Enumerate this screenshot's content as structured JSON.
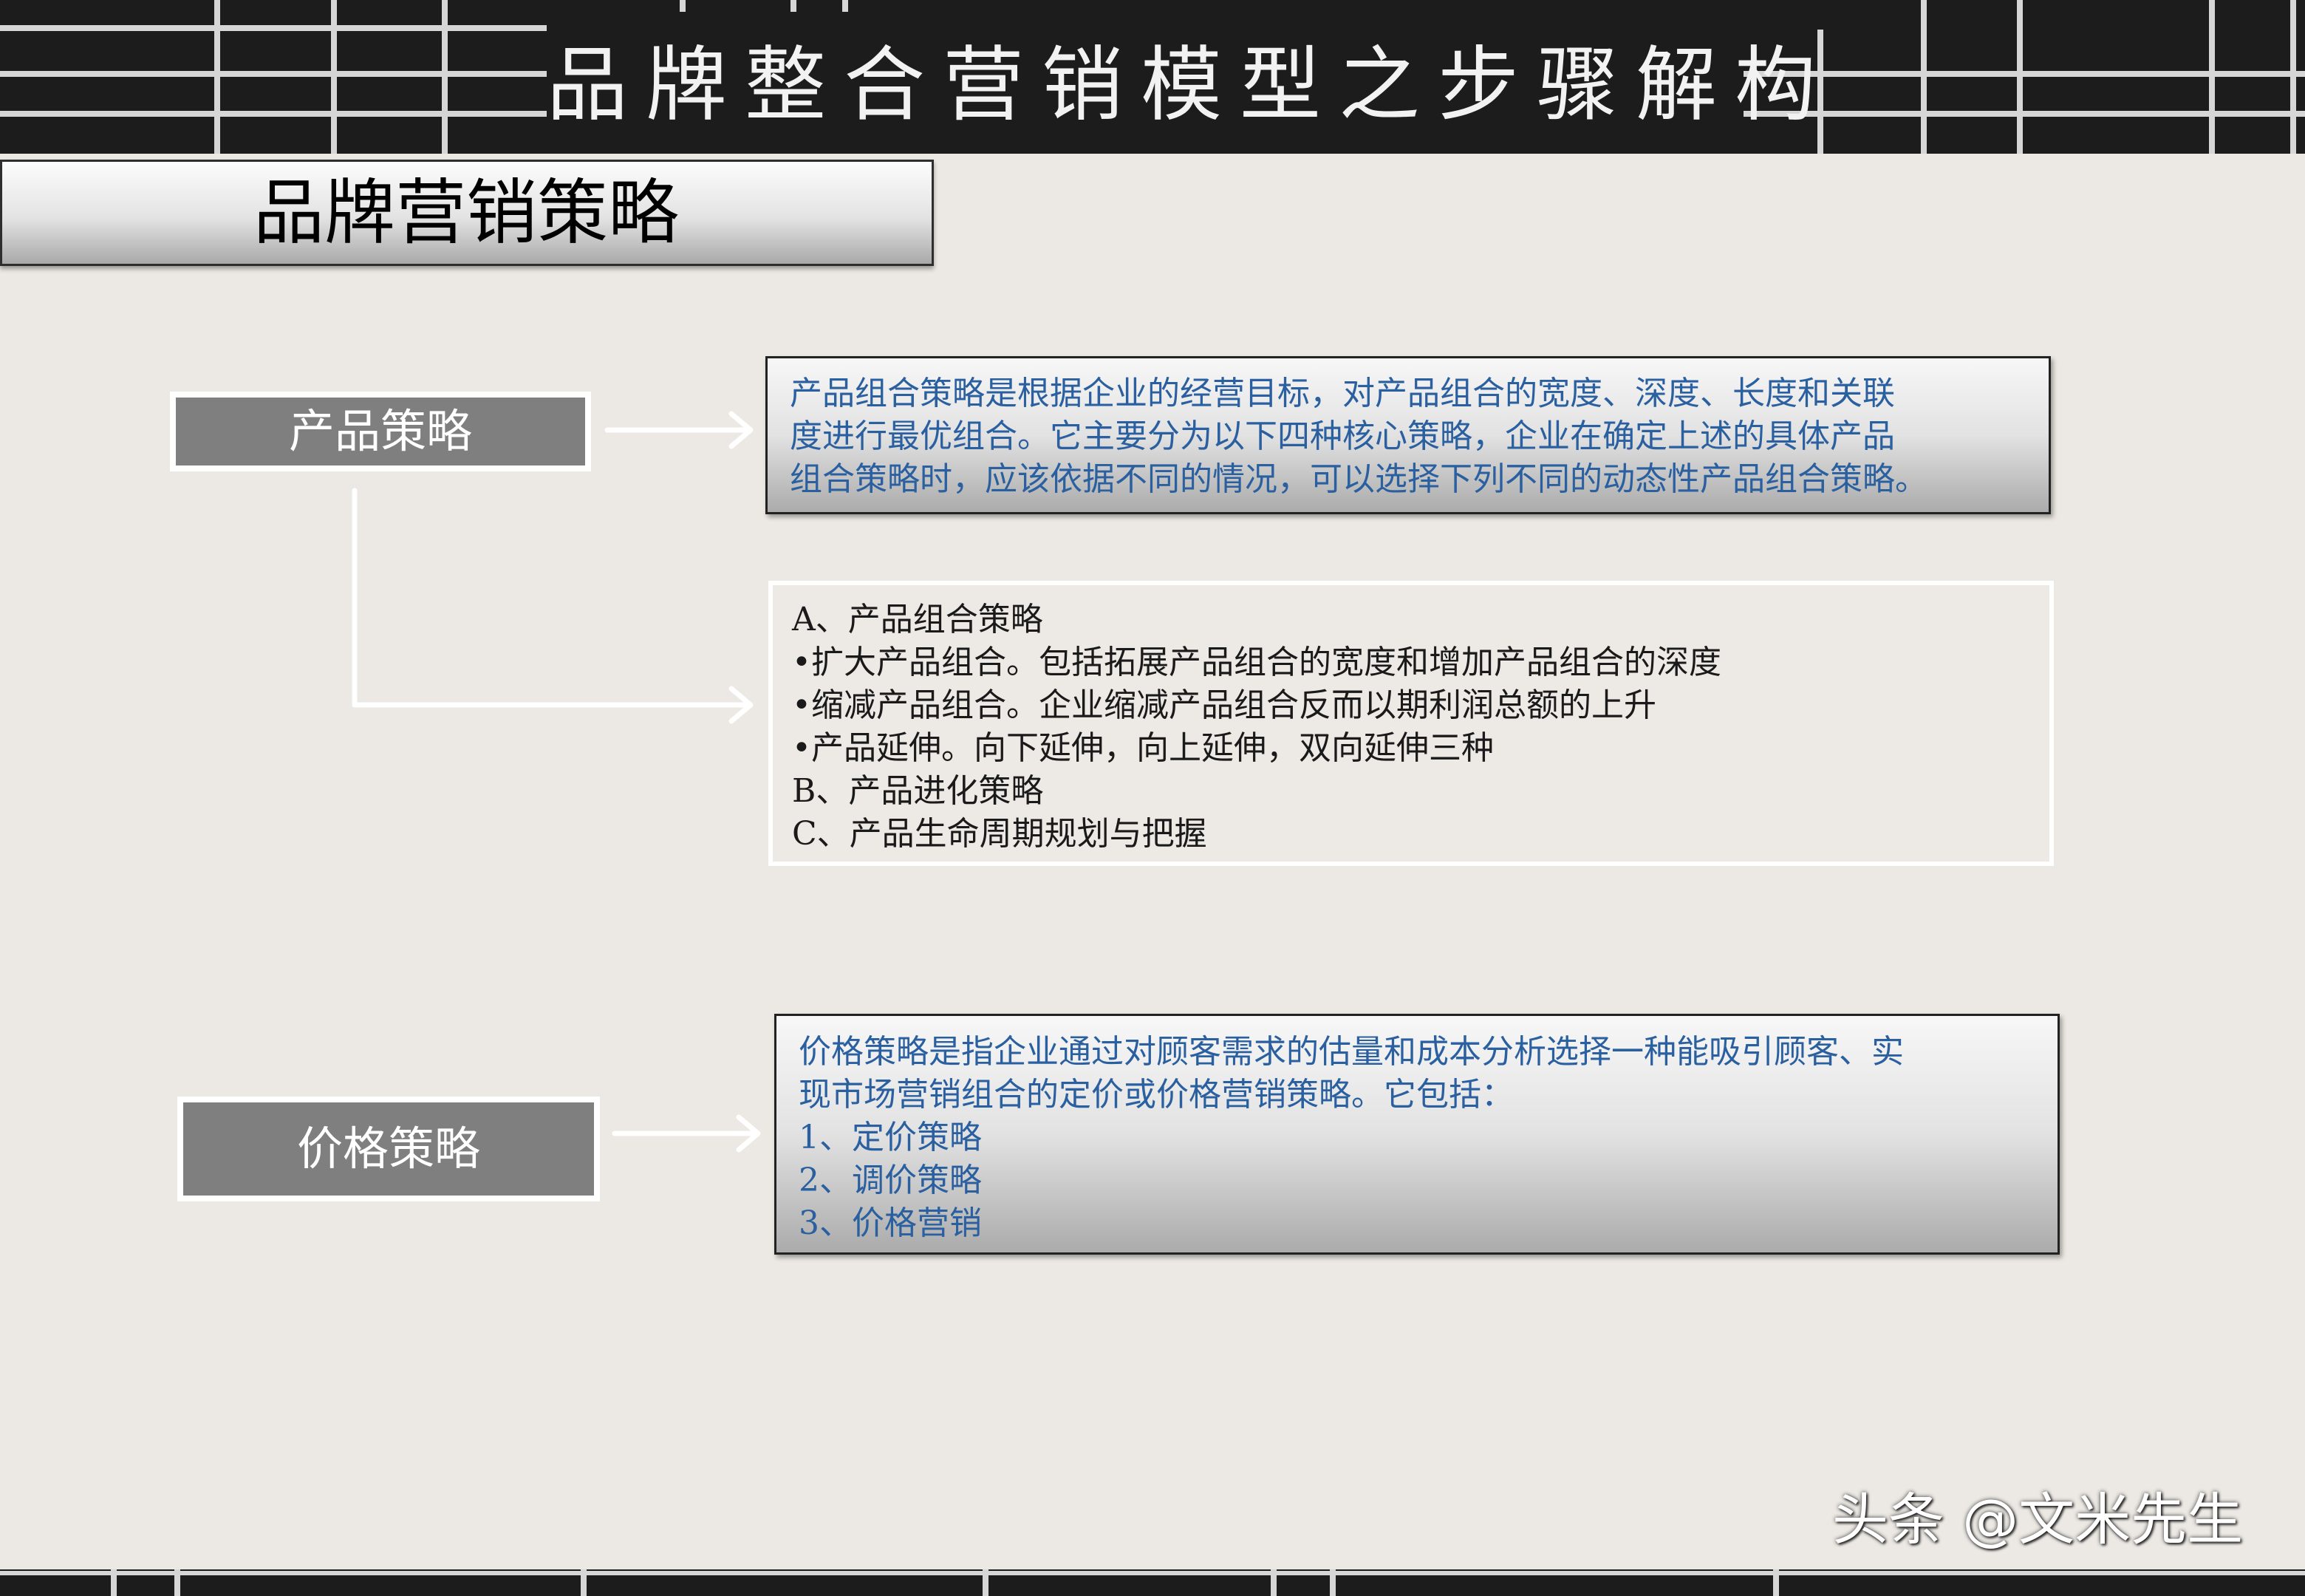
{
  "header": {
    "title": "品牌整合营销模型之步骤解构"
  },
  "section": {
    "title": "品牌营销策略"
  },
  "product": {
    "label": "产品策略",
    "description_lines": [
      "产品组合策略是根据企业的经营目标，对产品组合的宽度、深度、长度和关联",
      "度进行最优组合。它主要分为以下四种核心策略，企业在确定上述的具体产品",
      "组合策略时，应该依据不同的情况，可以选择下列不同的动态性产品组合策略。"
    ],
    "list_lines": [
      "A、产品组合策略",
      " •扩大产品组合。包括拓展产品组合的宽度和增加产品组合的深度",
      " •缩减产品组合。企业缩减产品组合反而以期利润总额的上升",
      " •产品延伸。向下延伸，向上延伸，双向延伸三种",
      "B、产品进化策略",
      "C、产品生命周期规划与把握"
    ]
  },
  "price": {
    "label": "价格策略",
    "description_lines": [
      "价格策略是指企业通过对顾客需求的估量和成本分析选择一种能吸引顾客、实",
      "现市场营销组合的定价或价格营销策略。它包括：",
      "1、定价策略",
      "2、调价策略",
      "3、价格营销"
    ]
  },
  "watermark": {
    "text": "头条 @文米先生"
  },
  "colors": {
    "header_bg": "#1c1c1c",
    "slide_bg": "#ece9e4",
    "label_bg": "#7f7f7f",
    "desc_text": "#2a5fa0",
    "list_text": "#1a1a1a"
  }
}
